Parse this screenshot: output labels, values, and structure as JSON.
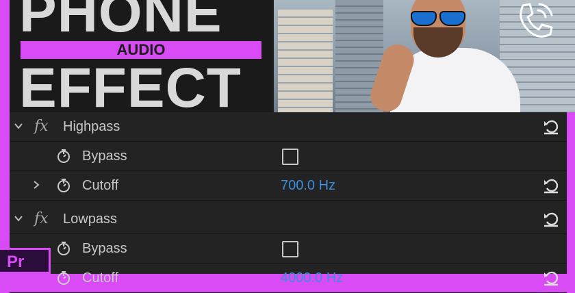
{
  "thumbnail": {
    "title_line1": "PHONE",
    "title_strip": "AUDIO",
    "title_line2": "EFFECT",
    "accent_color": "#d94bf5",
    "icon": "phone-call-icon"
  },
  "effects": {
    "highpass": {
      "name": "Highpass",
      "fx_label": "fx",
      "params": [
        {
          "label": "Bypass",
          "type": "checkbox",
          "checked": false
        },
        {
          "label": "Cutoff",
          "value": "700.0",
          "unit": "Hz"
        }
      ]
    },
    "lowpass": {
      "name": "Lowpass",
      "fx_label": "fx",
      "params": [
        {
          "label": "Bypass",
          "type": "checkbox",
          "checked": false
        },
        {
          "label": "Cutoff",
          "value": "4000.0",
          "unit": "Hz"
        }
      ]
    }
  },
  "app": {
    "logo_text": "Pr",
    "logo_icon": "premiere-pro-icon"
  }
}
